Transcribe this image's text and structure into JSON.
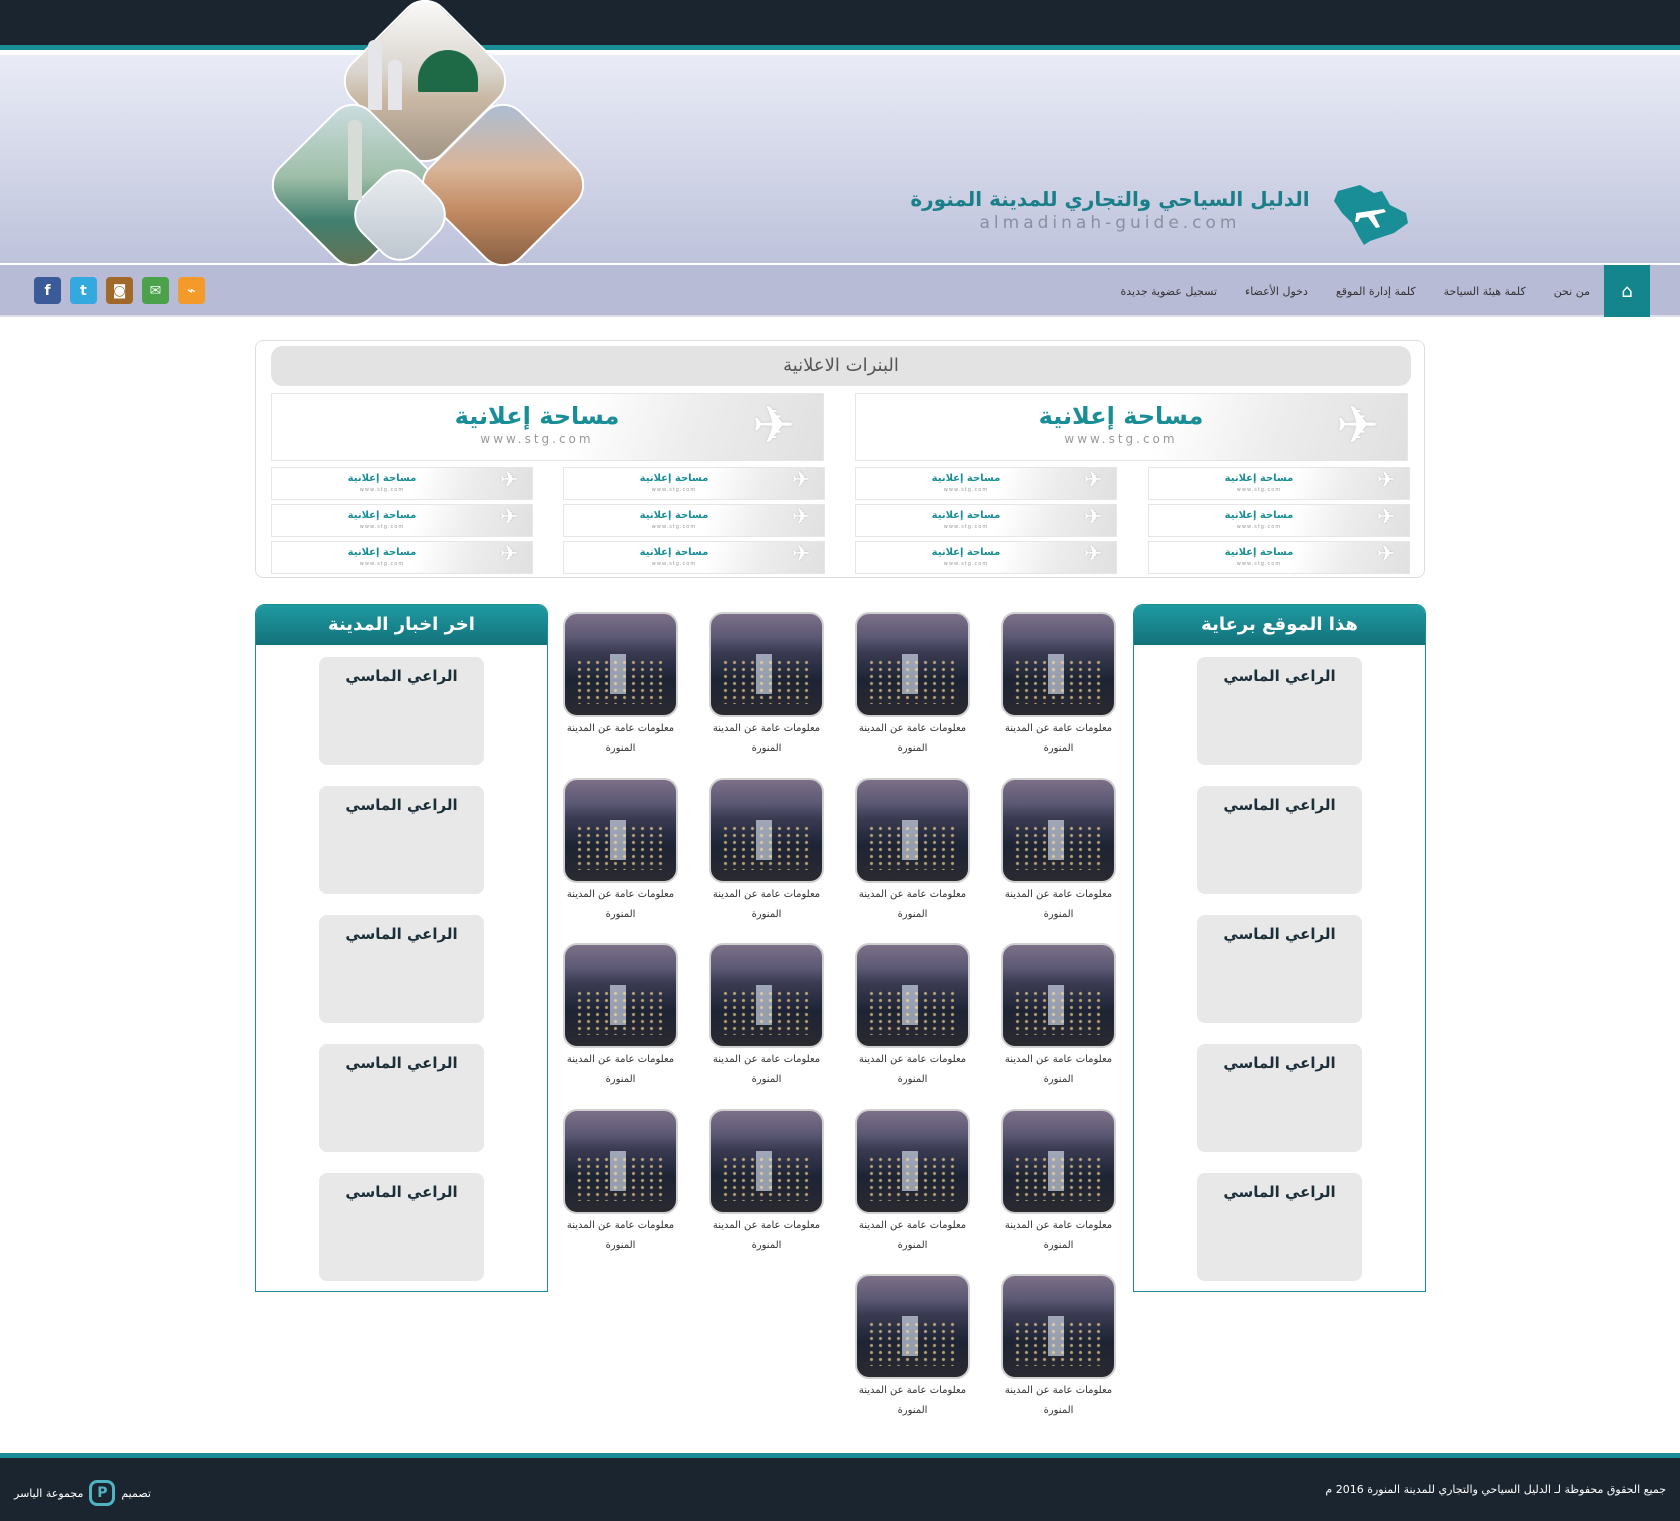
{
  "header": {
    "site_title": "الدليل السياحي والتجاري للمدينة المنورة",
    "site_domain": "almadinah-guide.com"
  },
  "nav": {
    "home_icon": "home-icon",
    "items": [
      {
        "label": "من نحن"
      },
      {
        "label": "كلمة هيئة السياحة"
      },
      {
        "label": "كلمة إدارة الموقع"
      },
      {
        "label": "دخول الأعضاء"
      },
      {
        "label": "تسجيل عضوية جديدة"
      }
    ]
  },
  "social": [
    {
      "name": "rss-icon",
      "glyph": "⌁",
      "color": "#f39a2b"
    },
    {
      "name": "email-icon",
      "glyph": "✉",
      "color": "#4ba24a"
    },
    {
      "name": "instagram-icon",
      "glyph": "◙",
      "color": "#a0692a"
    },
    {
      "name": "twitter-icon",
      "glyph": "t",
      "color": "#33a9e0"
    },
    {
      "name": "facebook-icon",
      "glyph": "f",
      "color": "#3a5a98"
    }
  ],
  "ads": {
    "title": "البنرات الاعلانية",
    "label": "مساحة إعلانية",
    "url": "www.stg.com"
  },
  "sponsors": {
    "title": "هذا الموقع برعاية",
    "items": [
      "الراعي الماسي",
      "الراعي الماسي",
      "الراعي الماسي",
      "الراعي الماسي",
      "الراعي الماسي"
    ]
  },
  "news": {
    "title": "اخر اخبار المدينة",
    "items": [
      "الراعي الماسي",
      "الراعي الماسي",
      "الراعي الماسي",
      "الراعي الماسي",
      "الراعي الماسي"
    ]
  },
  "tiles": {
    "caption_line1": "معلومات عامة عن المدينة",
    "caption_line2": "المنورة",
    "count": 18
  },
  "footer": {
    "copyright": "جميع الحقوق محفوظة لـ الدليل السياحي والتجاري للمدينة المنورة 2016 م",
    "design_label": "تصميم",
    "designer": "مجموعة الياسر"
  },
  "colors": {
    "teal": "#1a8e96",
    "dark": "#1b2530",
    "nav_bg": "#b8bbd6"
  }
}
